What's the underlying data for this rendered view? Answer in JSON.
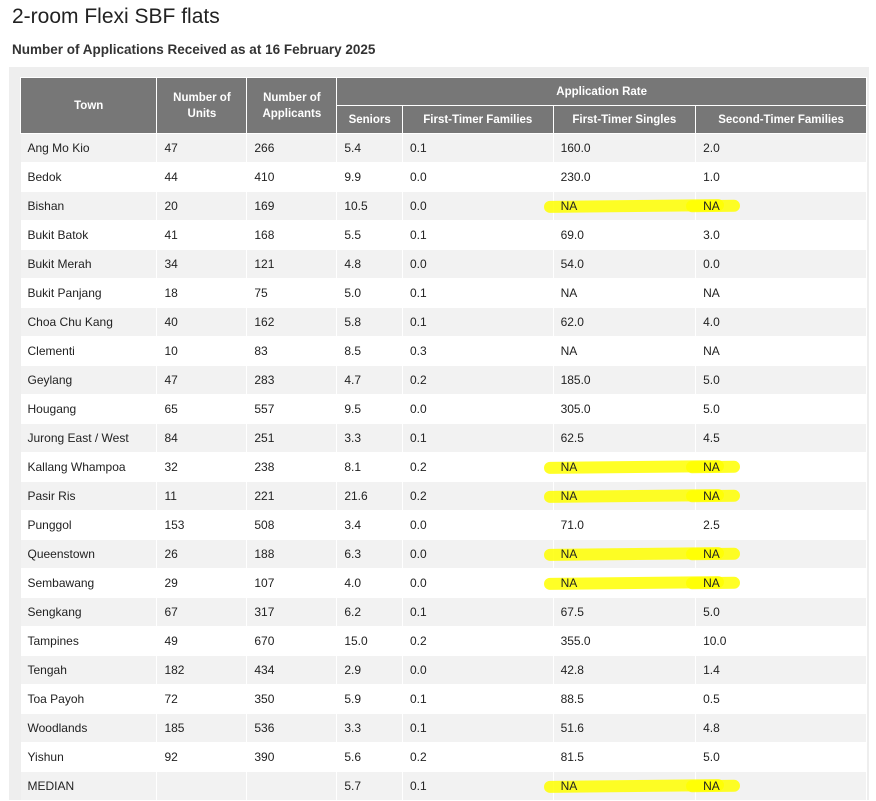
{
  "title": "2-room Flexi SBF flats",
  "subtitle": "Number of Applications Received as at 16 February 2025",
  "headers": {
    "town": "Town",
    "units": "Number of Units",
    "applicants": "Number of Applicants",
    "rate_group": "Application Rate",
    "seniors": "Seniors",
    "ftf": "First-Timer Families",
    "fts": "First-Timer Singles",
    "stf": "Second-Timer Families"
  },
  "highlight_color": "#ffff00",
  "rows": [
    {
      "town": "Ang Mo Kio",
      "units": "47",
      "applicants": "266",
      "seniors": "5.4",
      "ftf": "0.1",
      "fts": "160.0",
      "stf": "2.0",
      "highlight": false
    },
    {
      "town": "Bedok",
      "units": "44",
      "applicants": "410",
      "seniors": "9.9",
      "ftf": "0.0",
      "fts": "230.0",
      "stf": "1.0",
      "highlight": false
    },
    {
      "town": "Bishan",
      "units": "20",
      "applicants": "169",
      "seniors": "10.5",
      "ftf": "0.0",
      "fts": "NA",
      "stf": "NA",
      "highlight": true
    },
    {
      "town": "Bukit Batok",
      "units": "41",
      "applicants": "168",
      "seniors": "5.5",
      "ftf": "0.1",
      "fts": "69.0",
      "stf": "3.0",
      "highlight": false
    },
    {
      "town": "Bukit Merah",
      "units": "34",
      "applicants": "121",
      "seniors": "4.8",
      "ftf": "0.0",
      "fts": "54.0",
      "stf": "0.0",
      "highlight": false
    },
    {
      "town": "Bukit Panjang",
      "units": "18",
      "applicants": "75",
      "seniors": "5.0",
      "ftf": "0.1",
      "fts": "NA",
      "stf": "NA",
      "highlight": false
    },
    {
      "town": "Choa Chu Kang",
      "units": "40",
      "applicants": "162",
      "seniors": "5.8",
      "ftf": "0.1",
      "fts": "62.0",
      "stf": "4.0",
      "highlight": false
    },
    {
      "town": "Clementi",
      "units": "10",
      "applicants": "83",
      "seniors": "8.5",
      "ftf": "0.3",
      "fts": "NA",
      "stf": "NA",
      "highlight": false
    },
    {
      "town": "Geylang",
      "units": "47",
      "applicants": "283",
      "seniors": "4.7",
      "ftf": "0.2",
      "fts": "185.0",
      "stf": "5.0",
      "highlight": false
    },
    {
      "town": "Hougang",
      "units": "65",
      "applicants": "557",
      "seniors": "9.5",
      "ftf": "0.0",
      "fts": "305.0",
      "stf": "5.0",
      "highlight": false
    },
    {
      "town": "Jurong East / West",
      "units": "84",
      "applicants": "251",
      "seniors": "3.3",
      "ftf": "0.1",
      "fts": "62.5",
      "stf": "4.5",
      "highlight": false
    },
    {
      "town": "Kallang Whampoa",
      "units": "32",
      "applicants": "238",
      "seniors": "8.1",
      "ftf": "0.2",
      "fts": "NA",
      "stf": "NA",
      "highlight": true
    },
    {
      "town": "Pasir Ris",
      "units": "11",
      "applicants": "221",
      "seniors": "21.6",
      "ftf": "0.2",
      "fts": "NA",
      "stf": "NA",
      "highlight": true
    },
    {
      "town": "Punggol",
      "units": "153",
      "applicants": "508",
      "seniors": "3.4",
      "ftf": "0.0",
      "fts": "71.0",
      "stf": "2.5",
      "highlight": false
    },
    {
      "town": "Queenstown",
      "units": "26",
      "applicants": "188",
      "seniors": "6.3",
      "ftf": "0.0",
      "fts": "NA",
      "stf": "NA",
      "highlight": true
    },
    {
      "town": "Sembawang",
      "units": "29",
      "applicants": "107",
      "seniors": "4.0",
      "ftf": "0.0",
      "fts": "NA",
      "stf": "NA",
      "highlight": true
    },
    {
      "town": "Sengkang",
      "units": "67",
      "applicants": "317",
      "seniors": "6.2",
      "ftf": "0.1",
      "fts": "67.5",
      "stf": "5.0",
      "highlight": false
    },
    {
      "town": "Tampines",
      "units": "49",
      "applicants": "670",
      "seniors": "15.0",
      "ftf": "0.2",
      "fts": "355.0",
      "stf": "10.0",
      "highlight": false
    },
    {
      "town": "Tengah",
      "units": "182",
      "applicants": "434",
      "seniors": "2.9",
      "ftf": "0.0",
      "fts": "42.8",
      "stf": "1.4",
      "highlight": false
    },
    {
      "town": "Toa Payoh",
      "units": "72",
      "applicants": "350",
      "seniors": "5.9",
      "ftf": "0.1",
      "fts": "88.5",
      "stf": "0.5",
      "highlight": false
    },
    {
      "town": "Woodlands",
      "units": "185",
      "applicants": "536",
      "seniors": "3.3",
      "ftf": "0.1",
      "fts": "51.6",
      "stf": "4.8",
      "highlight": false
    },
    {
      "town": "Yishun",
      "units": "92",
      "applicants": "390",
      "seniors": "5.6",
      "ftf": "0.2",
      "fts": "81.5",
      "stf": "5.0",
      "highlight": false
    },
    {
      "town": "MEDIAN",
      "units": "",
      "applicants": "",
      "seniors": "5.7",
      "ftf": "0.1",
      "fts": "NA",
      "stf": "NA",
      "highlight": true
    }
  ]
}
